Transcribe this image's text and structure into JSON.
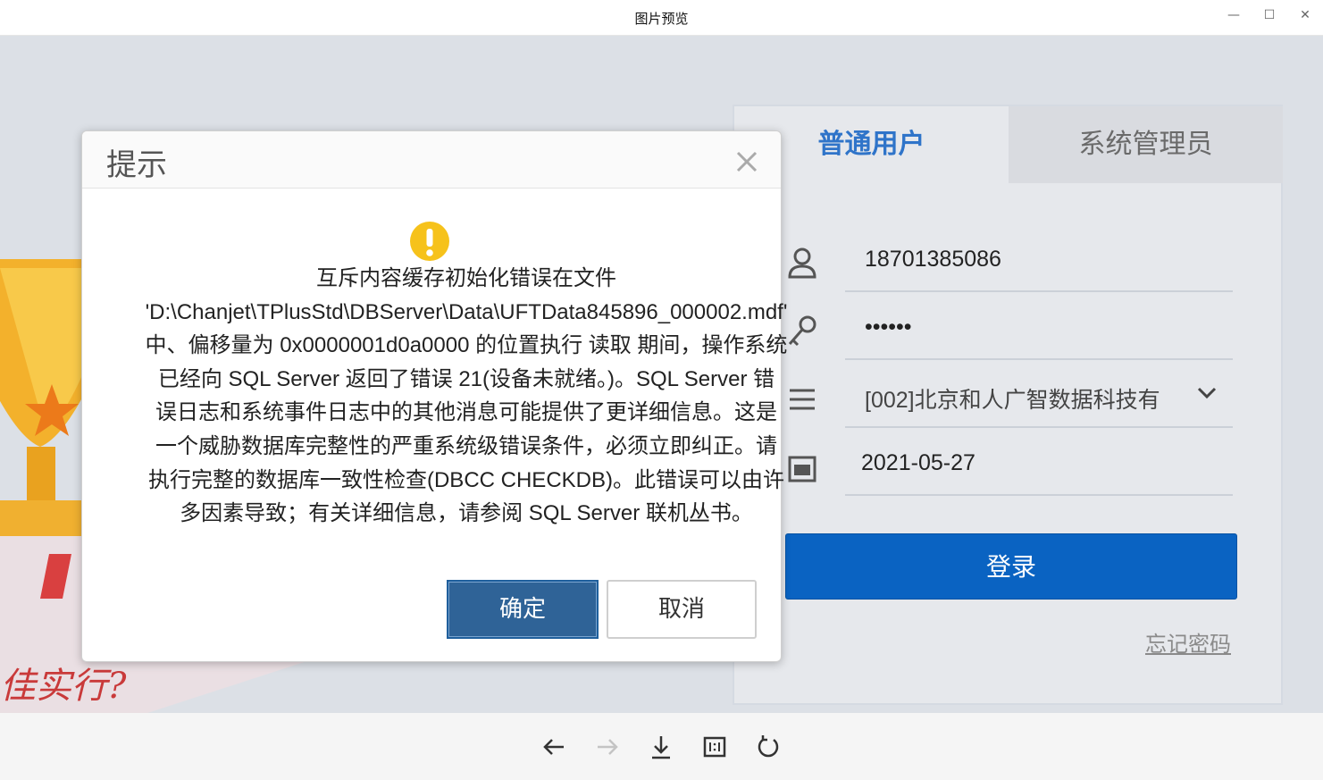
{
  "window": {
    "title": "图片预览",
    "minimize_glyph": "—",
    "maximize_glyph": "☐",
    "close_glyph": "✕"
  },
  "background": {
    "slogan_fragment": "佳实行?"
  },
  "login": {
    "tabs": [
      {
        "label": "普通用户",
        "active": true
      },
      {
        "label": "系统管理员",
        "active": false
      }
    ],
    "username": "18701385086",
    "password_mask": "••••••",
    "account_set": "[002]北京和人广智数据科技有",
    "date": "2021-05-27",
    "login_button": "登录",
    "forgot_password": "忘记密码"
  },
  "dialog": {
    "title": "提示",
    "icon": "warning-icon",
    "message_lines": [
      "互斥内容缓存初始化错误在文件",
      "'D:\\Chanjet\\TPlusStd\\DBServer\\Data\\UFTData845896_000002.mdf'",
      "中、偏移量为 0x0000001d0a0000 的位置执行 读取 期间，操作系统",
      "已经向 SQL Server 返回了错误 21(设备未就绪。)。SQL Server 错",
      "误日志和系统事件日志中的其他消息可能提供了更详细信息。这是",
      "一个威胁数据库完整性的严重系统级错误条件，必须立即纠正。请",
      "执行完整的数据库一致性检查(DBCC CHECKDB)。此错误可以由许",
      "多因素导致；有关详细信息，请参阅 SQL Server 联机丛书。"
    ],
    "ok_button": "确定",
    "cancel_button": "取消"
  },
  "toolbar": {
    "tools": [
      "back-arrow-icon",
      "forward-arrow-icon",
      "download-icon",
      "actual-size-icon",
      "rotate-icon"
    ]
  },
  "colors": {
    "accent_blue": "#0a63c2",
    "tab_active": "#2f74c9",
    "ok_button": "#2f6397",
    "warning": "#f6c21b"
  }
}
